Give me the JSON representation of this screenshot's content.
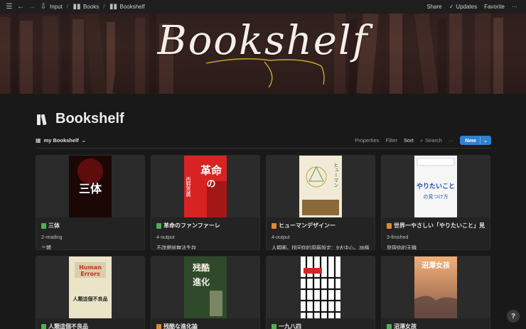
{
  "topbar": {
    "breadcrumbs": [
      "Input",
      "Books",
      "Bookshelf"
    ],
    "share": "Share",
    "updates": "Updates",
    "favorite": "Favorite"
  },
  "banner": {
    "title": "Bookshelf"
  },
  "page": {
    "title": "Bookshelf"
  },
  "view": {
    "name": "my Bookshelf",
    "properties": "Properties",
    "filter": "Filter",
    "sort": "Sort",
    "search": "Search",
    "more": "···",
    "new": "New"
  },
  "cards": [
    {
      "title": "三体",
      "status": "2-reading",
      "note": "三體",
      "icon_color": "#4caf50",
      "cover_bg": "#1a0606",
      "cover_text": "三体",
      "cover_text_color": "#ffffff"
    },
    {
      "title": "革命のファンファーレ",
      "status": "4-output",
      "note": "不改變就無法生存",
      "icon_color": "#4caf50",
      "cover_bg": "#d82323",
      "cover_text": "革命の",
      "cover_text_color": "#ffffff"
    },
    {
      "title": "ヒューマンデザインー",
      "status": "4-output",
      "note": "人類圖，找回你的原廠設定：9大中心、36條通道…",
      "icon_color": "#e08a2c",
      "cover_bg": "#f1ead6",
      "cover_text": "ヒューマン",
      "cover_text_color": "#2a6a4b"
    },
    {
      "title": "世界一やさしい「やりたいこと」見つ…",
      "status": "3-finished",
      "note": "發現你的天職",
      "icon_color": "#e08a2c",
      "cover_bg": "#f6f6f6",
      "cover_text": "やりたいこと",
      "cover_text_color": "#1d4f9c"
    },
    {
      "title": "人類這個不良品",
      "status": "",
      "note": "",
      "icon_color": "#4caf50",
      "cover_bg": "#ece4c9",
      "cover_text": "Human Errors",
      "cover_text_color": "#c0302a"
    },
    {
      "title": "残酷な進化論",
      "status": "",
      "note": "",
      "icon_color": "#e08a2c",
      "cover_bg": "#2f4a2b",
      "cover_text": "残酷な進化論",
      "cover_text_color": "#f4f1e6"
    },
    {
      "title": "一九八四",
      "status": "",
      "note": "",
      "icon_color": "#4caf50",
      "cover_bg": "#ffffff",
      "cover_text": "",
      "cover_text_color": "#d32525"
    },
    {
      "title": "沼澤女孩",
      "status": "",
      "note": "",
      "icon_color": "#4caf50",
      "cover_bg": "#e9a06a",
      "cover_text": "沼澤女孩",
      "cover_text_color": "#ffffff"
    }
  ],
  "help": "?"
}
